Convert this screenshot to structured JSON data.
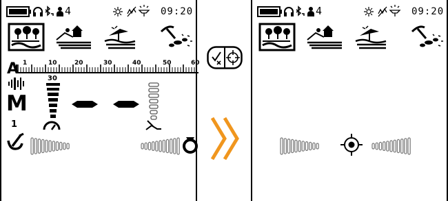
{
  "left_screen": {
    "status": {
      "battery_icon": "battery-full-icon",
      "headphones_icon": "headphones-icon",
      "bluetooth_icon": "bluetooth-low-icon",
      "user_icon": "user-icon",
      "user_count": "4",
      "backlight_icon": "backlight-icon",
      "vibration_icon": "vibration-off-icon",
      "flashlight_icon": "flashlight-icon",
      "clock": "09:20"
    },
    "search_modes": [
      "park-mode-icon",
      "field-mode-icon",
      "beach-mode-icon",
      "gold-mode-icon"
    ],
    "selected_mode": "park-mode-icon",
    "ruler": {
      "label": "A",
      "ticks": [
        "1",
        "10",
        "20",
        "30",
        "40",
        "50",
        "60"
      ]
    },
    "sensitivity": {
      "value": "30",
      "mode_letter": "M",
      "freq_label": "1"
    },
    "target_id_dashes": [
      "—",
      "—"
    ],
    "colors": {
      "accent": "#f0961e",
      "ink": "#000000",
      "dim": "#888888"
    }
  },
  "right_screen": {
    "status": {
      "battery_icon": "battery-full-icon",
      "headphones_icon": "headphones-icon",
      "bluetooth_icon": "bluetooth-low-icon",
      "user_icon": "user-icon",
      "user_count": "4",
      "backlight_icon": "backlight-icon",
      "vibration_icon": "vibration-off-icon",
      "flashlight_icon": "flashlight-icon",
      "clock": "09:20"
    },
    "search_modes": [
      "park-mode-icon",
      "field-mode-icon",
      "beach-mode-icon",
      "gold-mode-icon"
    ],
    "pinpoint_icon": "pinpoint-crosshair-icon"
  },
  "transition": {
    "mode_switch_icon": "discrimination-pinpoint-switch-icon",
    "arrow_icon": "double-chevron-right-icon"
  }
}
